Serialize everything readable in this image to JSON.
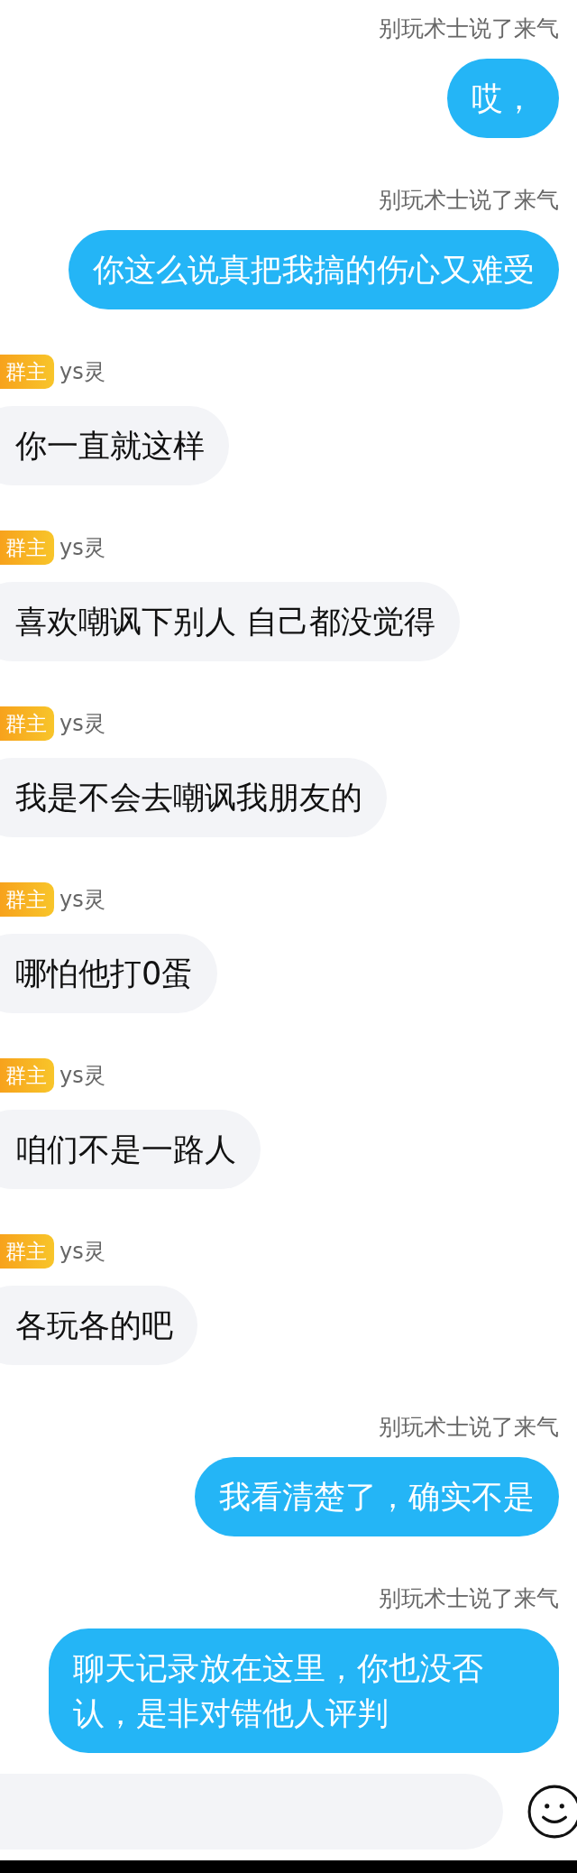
{
  "messages": [
    {
      "kind": "outgoing",
      "sender": "别玩术士说了来气",
      "text": "哎，"
    },
    {
      "kind": "outgoing",
      "sender": "别玩术士说了来气",
      "text": "你这么说真把我搞的伤心又难受"
    },
    {
      "kind": "incoming",
      "badge": "群主",
      "sender": "ys灵",
      "text": "你一直就这样"
    },
    {
      "kind": "incoming",
      "badge": "群主",
      "sender": "ys灵",
      "text": "喜欢嘲讽下别人 自己都没觉得"
    },
    {
      "kind": "incoming",
      "badge": "群主",
      "sender": "ys灵",
      "text": "我是不会去嘲讽我朋友的"
    },
    {
      "kind": "incoming",
      "badge": "群主",
      "sender": "ys灵",
      "text": "哪怕他打0蛋"
    },
    {
      "kind": "incoming",
      "badge": "群主",
      "sender": "ys灵",
      "text": "咱们不是一路人"
    },
    {
      "kind": "incoming",
      "badge": "群主",
      "sender": "ys灵",
      "text": "各玩各的吧"
    },
    {
      "kind": "outgoing",
      "sender": "别玩术士说了来气",
      "text": "我看清楚了，确实不是"
    },
    {
      "kind": "outgoing",
      "sender": "别玩术士说了来气",
      "text": "聊天记录放在这里，你也没否认，是非对错他人评判"
    }
  ],
  "input": {
    "kind": "text"
  }
}
